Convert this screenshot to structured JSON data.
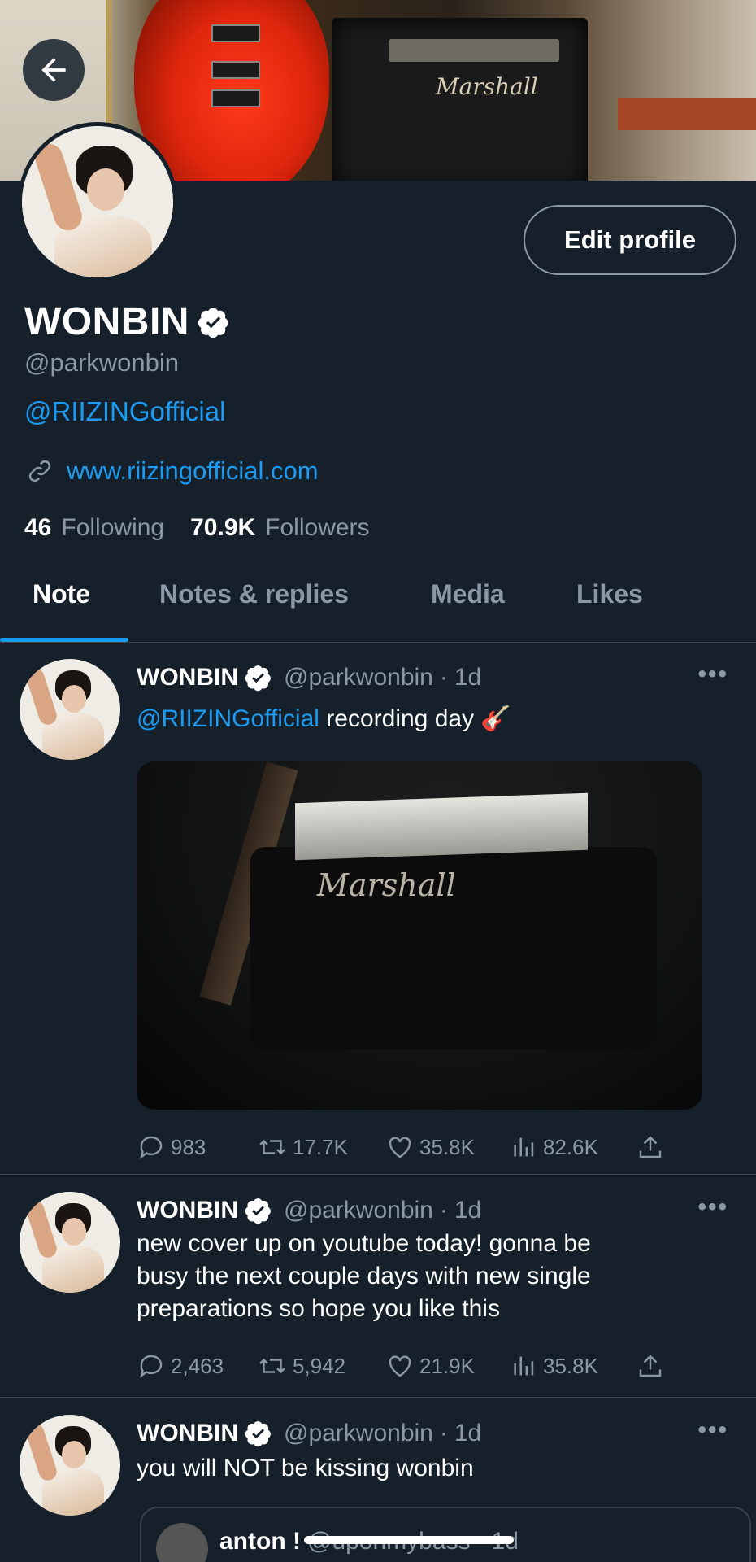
{
  "header": {
    "back_label": "Back"
  },
  "profile": {
    "name": "WONBIN",
    "handle": "@parkwonbin",
    "bio_mention": "@RIIZINGofficial",
    "website": "www.riizingofficial.com",
    "following_count": "46",
    "following_label": "Following",
    "followers_count": "70.9K",
    "followers_label": "Followers",
    "edit_label": "Edit profile"
  },
  "tabs": [
    {
      "label": "Note",
      "active": true
    },
    {
      "label": "Notes & replies",
      "active": false
    },
    {
      "label": "Media",
      "active": false
    },
    {
      "label": "Likes",
      "active": false
    }
  ],
  "banner": {
    "amp_brand": "Marshall"
  },
  "posts": [
    {
      "name": "WONBIN",
      "handle": "@parkwonbin",
      "time": "1d",
      "sep": "·",
      "mention": "@RIIZINGofficial",
      "text": "recording day",
      "emoji": "🎸",
      "media_brand": "Marshall",
      "replies": "983",
      "reposts": "17.7K",
      "likes": "35.8K",
      "views": "82.6K"
    },
    {
      "name": "WONBIN",
      "handle": "@parkwonbin",
      "time": "1d",
      "sep": "·",
      "text_lines": [
        "new cover up on youtube today! gonna be",
        "busy the next couple days with new single",
        "preparations so hope you like this"
      ],
      "replies": "2,463",
      "reposts": "5,942",
      "likes": "21.9K",
      "views": "35.8K"
    },
    {
      "name": "WONBIN",
      "handle": "@parkwonbin",
      "time": "1d",
      "sep": "·",
      "text": "you will NOT be kissing wonbin",
      "quote": {
        "name": "anton !",
        "handle": "@uponmybass",
        "time": "1d",
        "sep": "·"
      }
    }
  ],
  "more_label": "•••",
  "colors": {
    "background": "#15202b",
    "accent": "#1d9bf0",
    "muted": "#8b98a5",
    "divider": "#38444d"
  },
  "icons": [
    "back-arrow-icon",
    "verified-badge-icon",
    "link-icon",
    "reply-icon",
    "repost-icon",
    "like-icon",
    "views-icon",
    "share-icon",
    "more-icon"
  ]
}
